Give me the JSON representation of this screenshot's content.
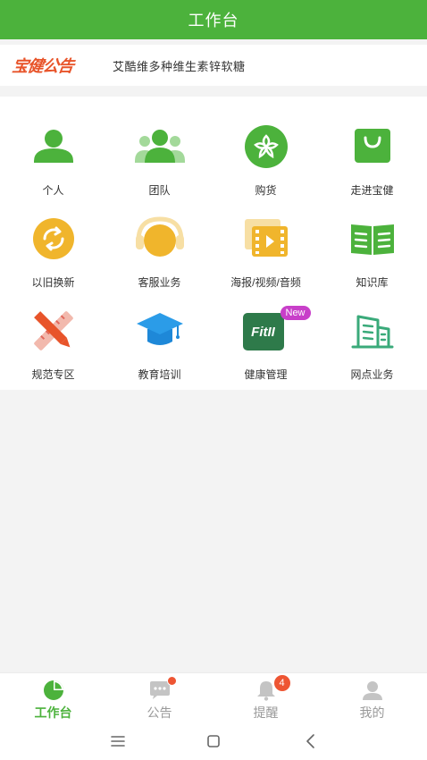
{
  "header": {
    "title": "工作台"
  },
  "notice": {
    "logo_text": "宝健公告",
    "text": "艾酷维多种维生素锌软糖"
  },
  "grid": {
    "items": [
      {
        "label": "个人",
        "icon": "person-icon"
      },
      {
        "label": "团队",
        "icon": "team-icon"
      },
      {
        "label": "购货",
        "icon": "flower-icon"
      },
      {
        "label": "走进宝健",
        "icon": "bag-icon"
      },
      {
        "label": "以旧换新",
        "icon": "refresh-icon"
      },
      {
        "label": "客服业务",
        "icon": "headset-icon"
      },
      {
        "label": "海报/视频/音频",
        "icon": "film-icon"
      },
      {
        "label": "知识库",
        "icon": "book-icon"
      },
      {
        "label": "规范专区",
        "icon": "ruler-pencil-icon"
      },
      {
        "label": "教育培训",
        "icon": "graduation-cap-icon"
      },
      {
        "label": "健康管理",
        "icon": "fitii-icon",
        "badge": "New",
        "icon_text": "FitII"
      },
      {
        "label": "网点业务",
        "icon": "building-icon"
      }
    ]
  },
  "tabbar": {
    "tabs": [
      {
        "label": "工作台",
        "icon": "pie-chart-icon",
        "active": true
      },
      {
        "label": "公告",
        "icon": "chat-icon",
        "dot": true
      },
      {
        "label": "提醒",
        "icon": "bell-icon",
        "badge": "4"
      },
      {
        "label": "我的",
        "icon": "user-icon"
      }
    ]
  },
  "colors": {
    "primary": "#4cb23c",
    "accent_red": "#ee5533",
    "badge_pink": "#c83fc9",
    "icon_yellow": "#f0b52c"
  }
}
